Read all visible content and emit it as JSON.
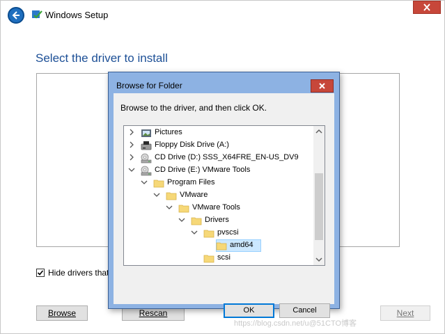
{
  "window": {
    "title": "Windows Setup",
    "heading": "Select the driver to install",
    "hide_drivers_label": "Hide drivers that",
    "hide_drivers_checked": true,
    "browse_button": "Browse",
    "rescan_button": "Rescan",
    "next_button": "Next"
  },
  "dialog": {
    "title": "Browse for Folder",
    "instruction": "Browse to the driver, and then click OK.",
    "ok_button": "OK",
    "cancel_button": "Cancel",
    "tree": [
      {
        "label": "Pictures",
        "icon": "pictures-folder-icon",
        "expander": "collapsed"
      },
      {
        "label": "Floppy Disk Drive (A:)",
        "icon": "floppy-drive-icon",
        "expander": "collapsed"
      },
      {
        "label": "CD Drive (D:) SSS_X64FRE_EN-US_DV9",
        "icon": "cd-drive-icon",
        "expander": "collapsed"
      },
      {
        "label": "CD Drive (E:) VMware Tools",
        "icon": "cd-drive-icon",
        "expander": "expanded"
      },
      {
        "label": "Program Files",
        "icon": "folder-icon",
        "expander": "expanded"
      },
      {
        "label": "VMware",
        "icon": "folder-icon",
        "expander": "expanded"
      },
      {
        "label": "VMware Tools",
        "icon": "folder-icon",
        "expander": "expanded"
      },
      {
        "label": "Drivers",
        "icon": "folder-icon",
        "expander": "expanded"
      },
      {
        "label": "pvscsi",
        "icon": "folder-icon",
        "expander": "expanded"
      },
      {
        "label": "amd64",
        "icon": "folder-icon",
        "expander": "none",
        "selected": true
      },
      {
        "label": "scsi",
        "icon": "folder-icon",
        "expander": "none"
      }
    ]
  },
  "watermark": "https://blog.csdn.net/u@51CTO博客",
  "colors": {
    "heading": "#1c4f96",
    "dialog_frame": "#8db2e3",
    "close_button": "#c7473a",
    "selection": "#cce8ff",
    "highlight_box": "#d8202e"
  }
}
